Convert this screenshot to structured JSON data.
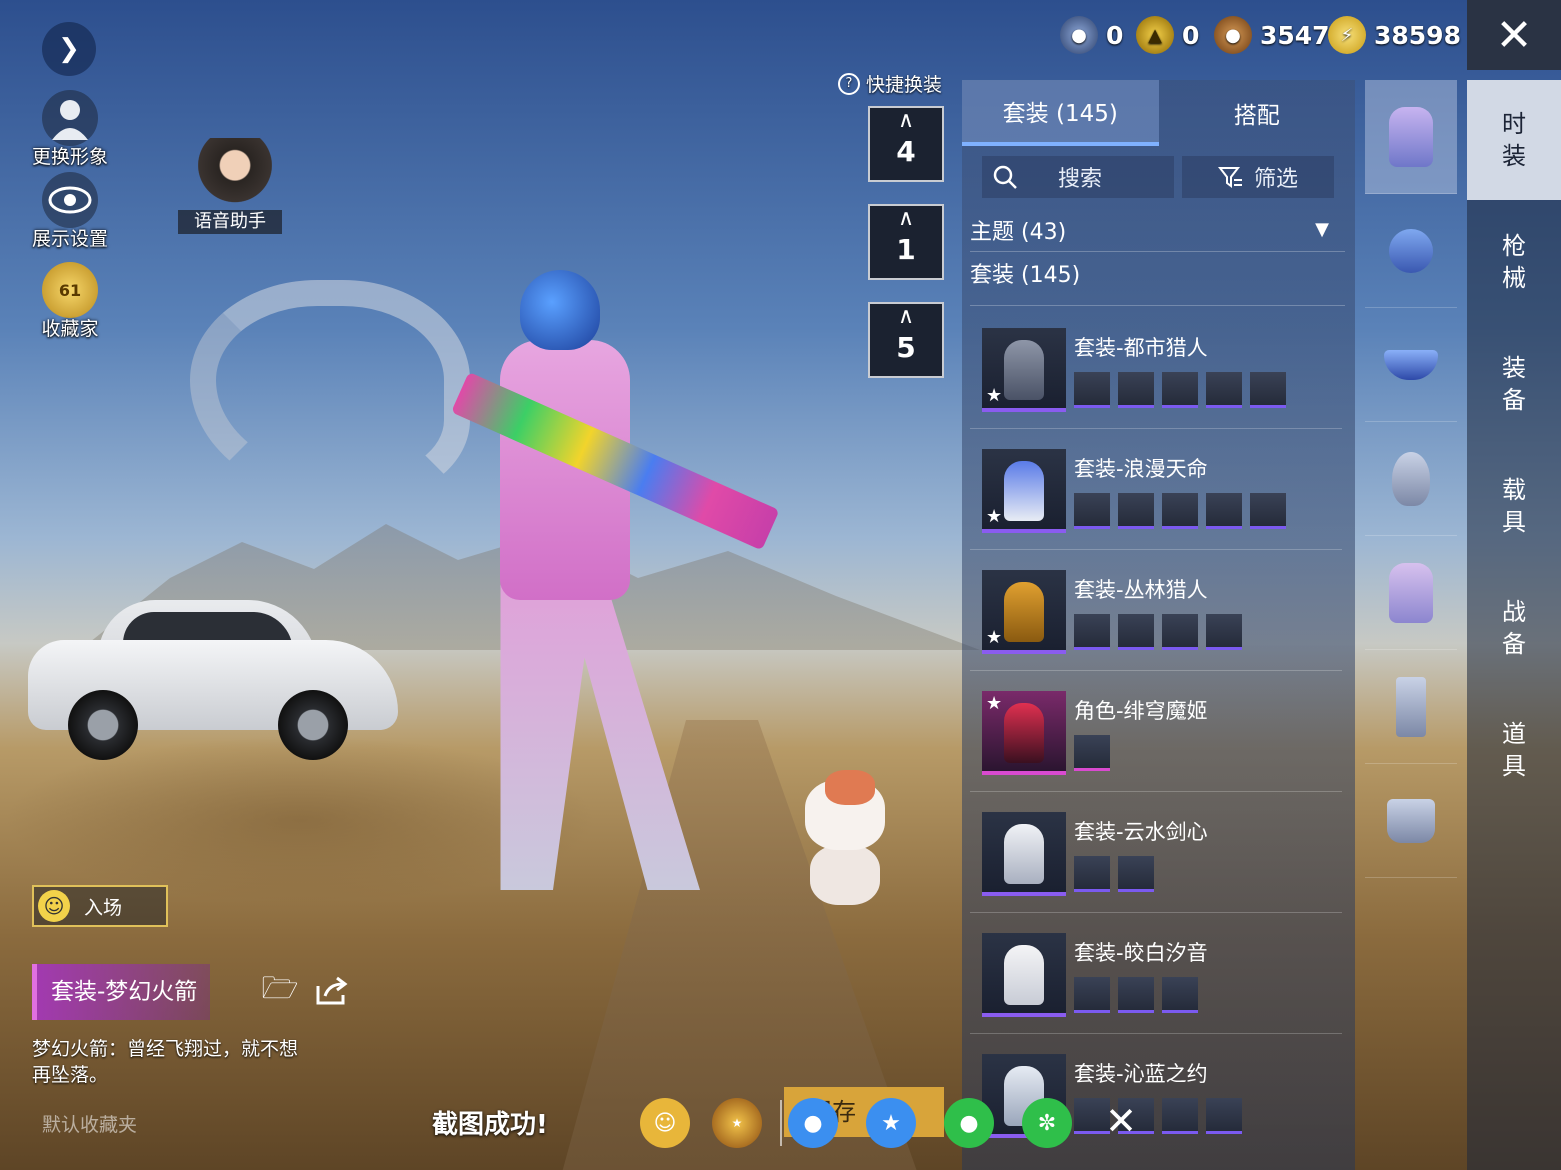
{
  "left_menu": {
    "change_avatar": "更换形象",
    "display_settings": "展示设置",
    "collector": "收藏家",
    "collector_level": "61",
    "voice_assistant": "语音助手"
  },
  "currency": {
    "item1": "0",
    "item2": "0",
    "item3": "3547",
    "item4": "38598"
  },
  "quick_change": {
    "title": "快捷换装",
    "slots": [
      "4",
      "1",
      "5"
    ]
  },
  "panel": {
    "tabs": [
      "套装 (145)",
      "搭配"
    ],
    "search_label": "搜索",
    "filter_label": "筛选",
    "theme_filter": "主题 (43)",
    "suit_count": "套装 (145)",
    "outfits": [
      {
        "name": "套装-都市猎人",
        "items": 5,
        "star": true
      },
      {
        "name": "套装-浪漫天命",
        "items": 5,
        "star": true
      },
      {
        "name": "套装-丛林猎人",
        "items": 4,
        "star": true
      },
      {
        "name": "角色-绯穹魔姬",
        "items": 1,
        "star": false
      },
      {
        "name": "套装-云水剑心",
        "items": 2,
        "star": false
      },
      {
        "name": "套装-皎白汐音",
        "items": 3,
        "star": false
      },
      {
        "name": "套装-沁蓝之约",
        "items": 4,
        "star": false
      }
    ]
  },
  "side_menu": [
    "时装",
    "枪械",
    "装备",
    "载具",
    "战备",
    "道具"
  ],
  "bottom_info": {
    "entry_label": "入场",
    "suit_name": "套装-梦幻火箭",
    "description": "梦幻火箭：曾经飞翔过，就不想再坠落。",
    "default_folder": "默认收藏夹"
  },
  "share_bar": {
    "screenshot_success": "截图成功!",
    "save_label": "保存"
  },
  "colors": {
    "panel_accent": "#7fb1ff",
    "suit_accent": "#a23ab0",
    "gold": "#d8a43a"
  }
}
